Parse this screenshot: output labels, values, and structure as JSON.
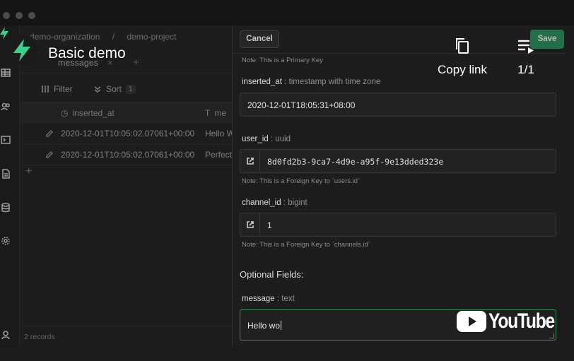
{
  "overlay": {
    "title": "Basic demo",
    "copy_link_label": "Copy link",
    "playlist_counter": "1/1",
    "youtube_wordmark": "YouTube"
  },
  "app": {
    "breadcrumbs": [
      "demo-organization",
      "/",
      "demo-project"
    ],
    "tab_label": "messages",
    "toolbar": {
      "filter_label": "Filter",
      "sort_label": "Sort",
      "sort_count": "1"
    },
    "columns": [
      "inserted_at",
      "me"
    ],
    "rows": [
      {
        "inserted_at": "2020-12-01T10:05:02.07061+00:00",
        "message": "Hello W"
      },
      {
        "inserted_at": "2020-12-01T10:05:02.07061+00:00",
        "message": "Perfect"
      }
    ],
    "record_count": "2 records"
  },
  "panel": {
    "cancel_label": "Cancel",
    "save_label": "Save",
    "primary_key_note": "Note: This is a Primary Key",
    "fields": {
      "inserted_at": {
        "name": "inserted_at",
        "type": ": timestamp with time zone",
        "value": "2020-12-01T18:05:31+08:00"
      },
      "user_id": {
        "name": "user_id",
        "type": ": uuid",
        "value": "8d0fd2b3-9ca7-4d9e-a95f-9e13dded323e",
        "note": "Note: This is a Foreign Key to `users.id`"
      },
      "channel_id": {
        "name": "channel_id",
        "type": ": bigint",
        "value": "1",
        "note": "Note: This is a Foreign Key to `channels.id`"
      },
      "message": {
        "name": "message",
        "type": ": text",
        "value": "Hello wo"
      }
    },
    "optional_heading": "Optional Fields:"
  },
  "colors": {
    "accent_green": "#3ecf8e",
    "save_green": "#2a8a55",
    "youtube_red": "#ffffff"
  }
}
